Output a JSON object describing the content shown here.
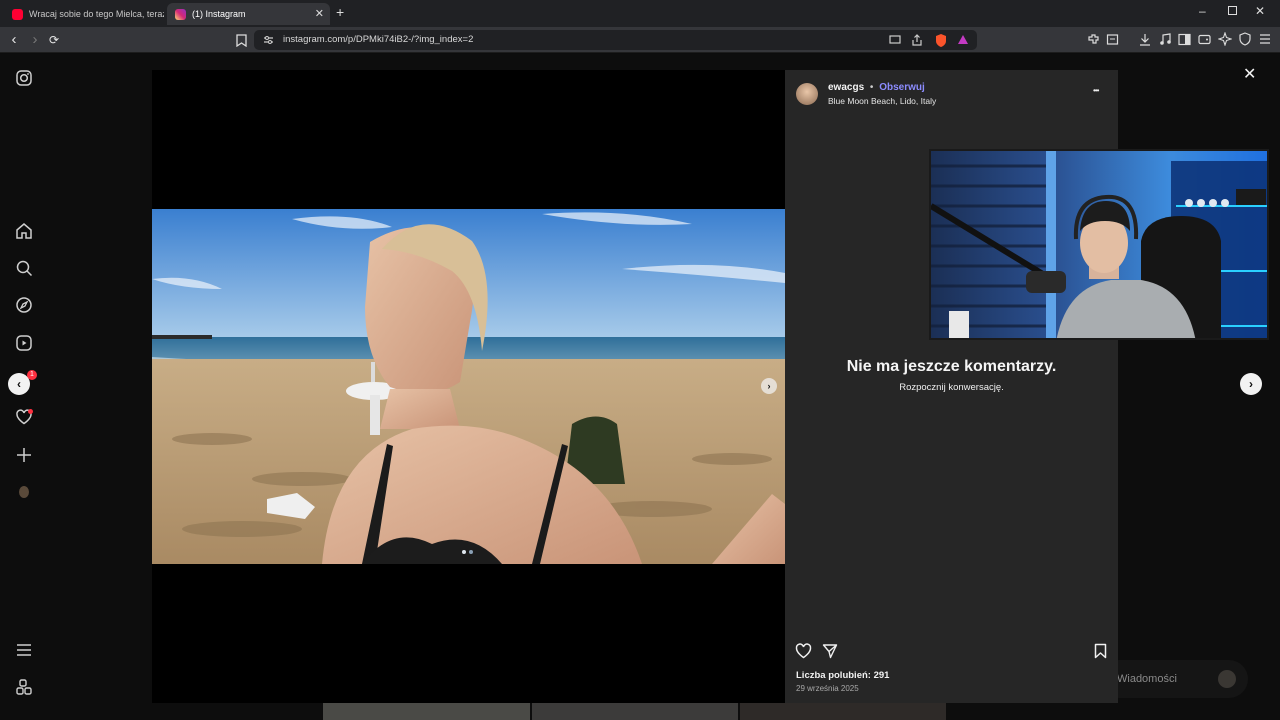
{
  "browser": {
    "tabs": [
      {
        "title": "Wracaj sobie do tego Mielca, teraz m",
        "favicon_color": "#ff0033"
      },
      {
        "title": "(1) Instagram",
        "favicon_color": "#d6249f"
      }
    ],
    "new_tab_label": "+",
    "url": "instagram.com/p/DPMki74iB2-/?img_index=2"
  },
  "sidebar": {
    "notifications_badge": "1",
    "icons": [
      "instagram-icon",
      "home-icon",
      "search-icon",
      "explore-icon",
      "reels-icon",
      "notifications-icon",
      "likes-icon",
      "create-icon",
      "profile-icon",
      "menu-icon",
      "also-from-meta-icon"
    ]
  },
  "post": {
    "username": "ewacgs",
    "separator": "•",
    "follow_label": "Obserwuj",
    "location": "Blue Moon Beach, Lido, Italy",
    "options_label": "•••",
    "no_comments_title": "Nie ma jeszcze komentarzy.",
    "no_comments_subtitle": "Rozpocznij konwersację.",
    "likes_label": "Liczba polubień: 291",
    "date": "29 września 2025",
    "carousel_count": 2,
    "carousel_active_index": 1
  },
  "messages": {
    "label": "Wiadomości"
  },
  "colors": {
    "follow": "#8c8cff",
    "panel_bg": "#262626",
    "accent_blue": "#0095f6"
  }
}
